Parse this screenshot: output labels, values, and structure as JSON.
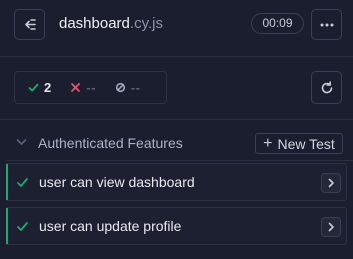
{
  "header": {
    "spec_base": "dashboard",
    "spec_ext": ".cy.js",
    "timer": "00:09"
  },
  "stats": {
    "passed": "2",
    "failed": "--",
    "pending": "--"
  },
  "suite": {
    "title": "Authenticated Features",
    "new_test_label": "New Test"
  },
  "tests": [
    {
      "title": "user can view dashboard",
      "state": "passed"
    },
    {
      "title": "user can update profile",
      "state": "passed"
    }
  ],
  "colors": {
    "background": "#1b1e2e",
    "passed": "#1fa971",
    "failed": "#e45770",
    "border": "#3a3f55"
  },
  "icons": {
    "back": "collapse-sidebar-icon",
    "more": "more-horizontal-icon",
    "rerun": "rerun-icon",
    "passed": "check-icon",
    "failed": "x-icon",
    "pending": "pending-icon",
    "suite": "chevron-down-icon",
    "add": "plus-icon",
    "open": "chevron-right-icon"
  }
}
